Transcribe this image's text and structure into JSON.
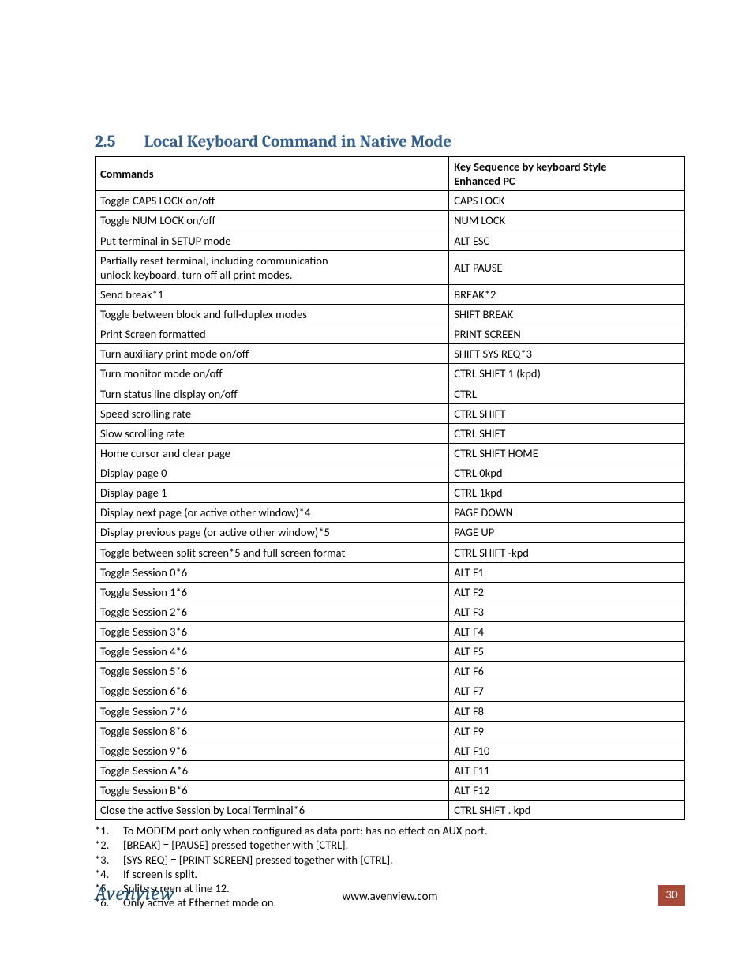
{
  "section": {
    "number": "2.5",
    "title": "Local Keyboard Command in Native Mode"
  },
  "table": {
    "head_left": "Commands",
    "head_right_line1": "Key Sequence by keyboard Style",
    "head_right_line2": "Enhanced PC",
    "rows": [
      {
        "cmd": "Toggle CAPS LOCK on/off",
        "key": "CAPS LOCK"
      },
      {
        "cmd": "Toggle NUM LOCK on/off",
        "key": "NUM LOCK"
      },
      {
        "cmd": "Put terminal in SETUP mode",
        "key": "ALT ESC"
      },
      {
        "cmd": "Partially reset terminal, including communication\nunlock keyboard, turn off all print modes.",
        "key": "ALT PAUSE"
      },
      {
        "cmd": "Send break*1",
        "key": "BREAK*2"
      },
      {
        "cmd": "Toggle between block and full-duplex modes",
        "key": "SHIFT BREAK"
      },
      {
        "cmd": "Print Screen formatted",
        "key": "PRINT SCREEN"
      },
      {
        "cmd": "Turn auxiliary print mode on/off",
        "key": "SHIFT SYS REQ*3"
      },
      {
        "cmd": "Turn monitor mode on/off",
        "key": "CTRL SHIFT 1 (kpd)"
      },
      {
        "cmd": "Turn status line display on/off",
        "key": "CTRL"
      },
      {
        "cmd": "Speed scrolling rate",
        "key": "CTRL SHIFT"
      },
      {
        "cmd": "Slow scrolling rate",
        "key": "CTRL SHIFT"
      },
      {
        "cmd": "Home cursor and clear page",
        "key": "CTRL SHIFT HOME"
      },
      {
        "cmd": "Display page 0",
        "key": "CTRL 0kpd"
      },
      {
        "cmd": "Display page 1",
        "key": "CTRL 1kpd"
      },
      {
        "cmd": "Display next page (or active other window)*4",
        "key": "PAGE DOWN"
      },
      {
        "cmd": "Display previous page (or active other window)*5",
        "key": "PAGE UP"
      },
      {
        "cmd": "Toggle between split screen*5 and full screen format",
        "key": "CTRL SHIFT -kpd"
      },
      {
        "cmd": "Toggle Session 0*6",
        "key": "ALT F1"
      },
      {
        "cmd": "Toggle Session 1*6",
        "key": "ALT F2"
      },
      {
        "cmd": "Toggle Session 2*6",
        "key": "ALT F3"
      },
      {
        "cmd": "Toggle Session 3*6",
        "key": "ALT F4"
      },
      {
        "cmd": "Toggle Session 4*6",
        "key": "ALT F5"
      },
      {
        "cmd": "Toggle Session 5*6",
        "key": "ALT F6"
      },
      {
        "cmd": "Toggle Session 6*6",
        "key": "ALT F7"
      },
      {
        "cmd": "Toggle Session 7*6",
        "key": "ALT F8"
      },
      {
        "cmd": "Toggle Session 8*6",
        "key": "ALT F9"
      },
      {
        "cmd": "Toggle Session 9*6",
        "key": "ALT F10"
      },
      {
        "cmd": "Toggle Session A*6",
        "key": "ALT F11"
      },
      {
        "cmd": "Toggle Session B*6",
        "key": "ALT F12"
      },
      {
        "cmd": "Close the active Session by Local Terminal*6",
        "key": "CTRL SHIFT .    kpd"
      }
    ]
  },
  "notes": [
    {
      "mark": "*1.",
      "text": "To MODEM port only when configured as data port: has no effect on AUX port."
    },
    {
      "mark": "*2.",
      "text": "[BREAK] = [PAUSE] pressed together with [CTRL]."
    },
    {
      "mark": "*3.",
      "text": "[SYS REQ] = [PRINT SCREEN] pressed together with [CTRL]."
    },
    {
      "mark": "*4.",
      "text": "If screen is split."
    },
    {
      "mark": "*5.",
      "text": "Splits screen at line 12."
    },
    {
      "mark": "*6.",
      "text": "Only active at Ethernet mode on."
    }
  ],
  "footer": {
    "brand": "Avenview",
    "site": "www.avenview.com",
    "page": "30"
  }
}
